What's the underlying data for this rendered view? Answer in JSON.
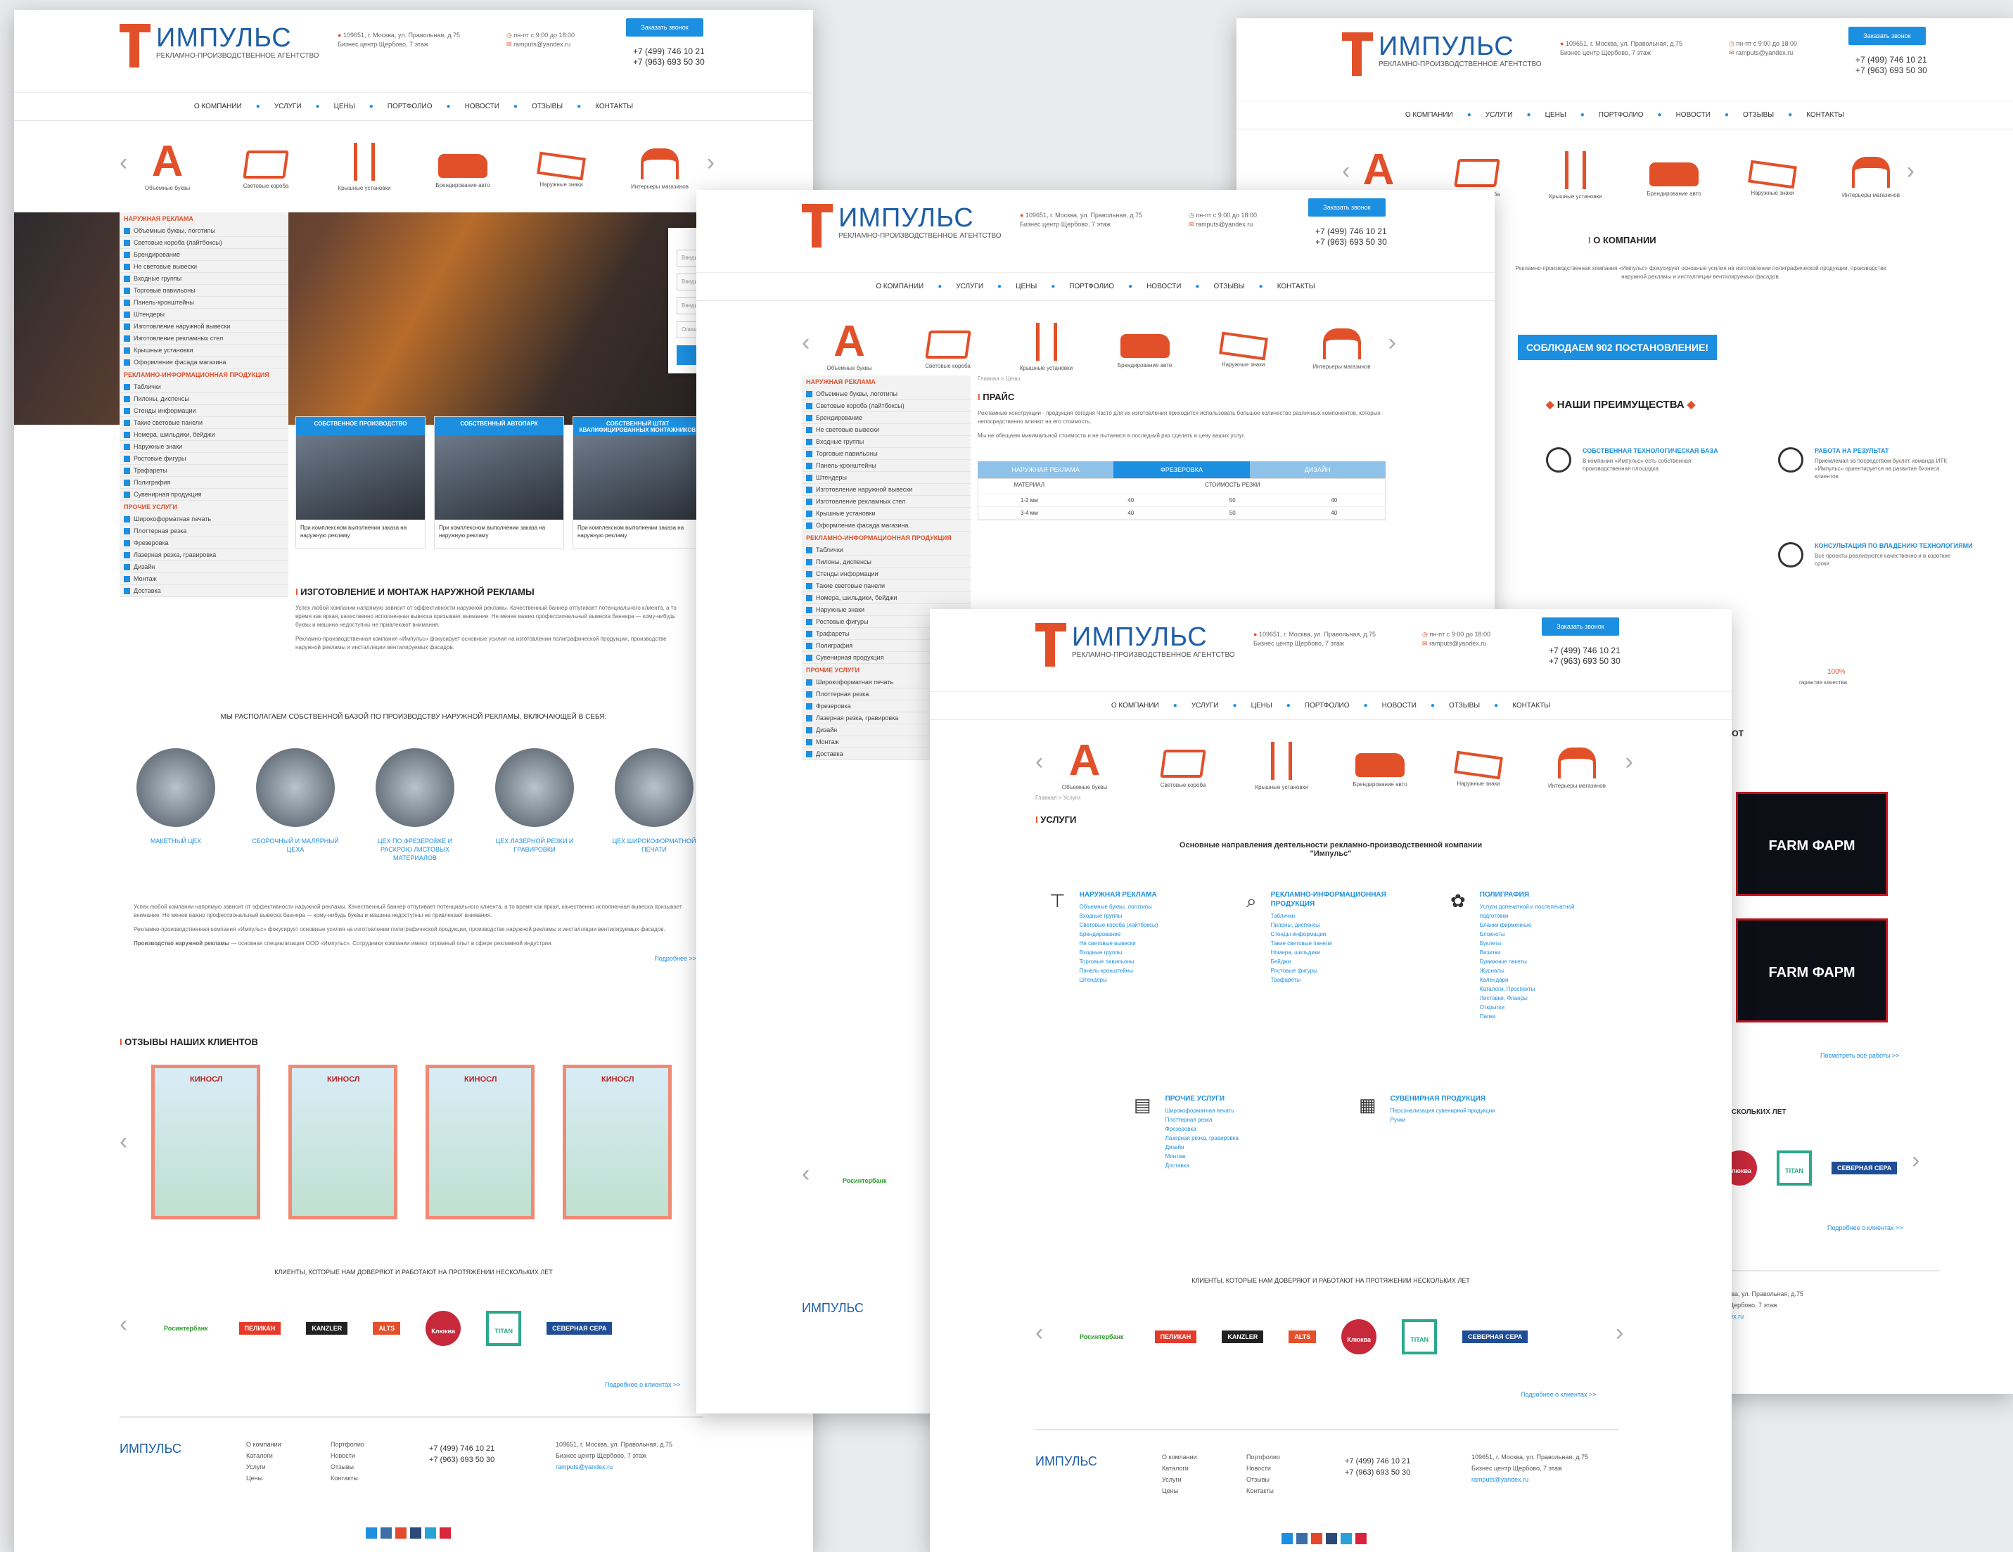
{
  "header": {
    "logo_name": "ИМПУЛЬС",
    "logo_sub": "РЕКЛАМНО-ПРОИЗВОДСТВЕННОЕ АГЕНТСТВО",
    "address": "109651, г. Москва, ул. Правольная, д.75",
    "address2": "Бизнес центр Щербово, 7 этаж",
    "hours": "пн-пт с 9:00 до 18:00",
    "email": "ramputs@yandex.ru",
    "phone1": "+7 (499) 746 10 21",
    "phone2": "+7 (963) 693 50 30",
    "callback": "Заказать звонок"
  },
  "menu": [
    "О КОМПАНИИ",
    "УСЛУГИ",
    "ЦЕНЫ",
    "ПОРТФОЛИО",
    "НОВОСТИ",
    "ОТЗЫВЫ",
    "КОНТАКТЫ"
  ],
  "products": [
    {
      "label": "Объемные буквы",
      "icon": "letter-a-icon"
    },
    {
      "label": "Световые короба",
      "icon": "light-box-icon"
    },
    {
      "label": "Крышные установки",
      "icon": "roof-stand-icon"
    },
    {
      "label": "Брендирование авто",
      "icon": "van-icon"
    },
    {
      "label": "Наружные знаки",
      "icon": "sign-icon"
    },
    {
      "label": "Интерьеры магазинов",
      "icon": "tent-icon"
    }
  ],
  "sidebar": {
    "cap1": "НАРУЖНАЯ РЕКЛАМА",
    "items1": [
      "Объемные буквы, логотипы",
      "Световые короба (лайтбоксы)",
      "Брендирование",
      "Не световые вывески",
      "Входные группы",
      "Торговые павильоны",
      "Панель-кронштейны",
      "Штендеры",
      "Изготовление наружной вывески",
      "Изготовление рекламных стел",
      "Крышные установки",
      "Оформление фасада магазина"
    ],
    "cap2": "РЕКЛАМНО-ИНФОРМАЦИОННАЯ ПРОДУКЦИЯ",
    "items2": [
      "Таблички",
      "Пилоны, диспенсы",
      "Стенды информации",
      "Такие световые панели",
      "Номера, шильдики, бейджи",
      "Наружные знаки",
      "Ростовые фигуры",
      "Трафареты",
      "Полиграфия",
      "Сувенирная продукция"
    ],
    "cap3": "ПРОЧИЕ УСЛУГИ",
    "items3": [
      "Широкоформатная печать",
      "Плоттерная резка",
      "Фрезеровка",
      "Лазерная резка, гравировка",
      "Дизайн",
      "Монтаж",
      "Доставка"
    ]
  },
  "order": {
    "title": "ОФОРМИТЬ ЗАКАЗ",
    "ph_name": "Введите Имя",
    "ph_phone": "Введите телефон",
    "ph_email": "Введите e-mail",
    "ph_service": "Опишите вид услуги",
    "submit": "ОТПРАВИТЬ"
  },
  "cards": [
    {
      "title": "СОБСТВЕННОЕ ПРОИЗВОДСТВО",
      "text": "При комплексном выполнении заказа на наружную рекламу"
    },
    {
      "title": "СОБСТВЕННЫЙ АВТОПАРК",
      "text": "При комплексном выполнении заказа на наружную рекламу"
    },
    {
      "title": "СОБСТВЕННЫЙ ШТАТ КВАЛИФИЦИРОВАННЫХ МОНТАЖНИКОВ",
      "text": "При комплексном выполнении заказа на наружную рекламу"
    }
  ],
  "main": {
    "section1_title": "ИЗГОТОВЛЕНИЕ И МОНТАЖ НАРУЖНОЙ РЕКЛАМЫ",
    "section1_text": "Успех любой компании напрямую зависит от эффективности наружной рекламы. Качественный баннер отпугивает потенциального клиента, а то время как яркая, качественно исполненная вывеска призывает внимание. Не менее важно профессиональный вывеска баннера — кому-нибудь буквы и машина недоступны не привлекают внимания.",
    "section1_text2": "Рекламно-производственная компания «Импульс» фокусирует основные усилия на изготовлении полиграфической продукции, производстве наружной рекламы и инсталляции вентилируемых фасадов.",
    "base_title": "МЫ РАСПОЛАГАЕМ СОБСТВЕННОЙ БАЗОЙ ПО ПРОИЗВОДСТВУ НАРУЖНОЙ РЕКЛАМЫ, ВКЛЮЧАЮЩЕЙ В СЕБЯ:",
    "circles": [
      "МАКЕТНЫЙ ЦЕХ",
      "СБОРОЧНЫЙ И МАЛЯРНЫЙ ЦЕХА",
      "ЦЕХ ПО ФРЕЗЕРОВКЕ И РАСКРОЮ ЛИСТОВЫХ МАТЕРИАЛОВ",
      "ЦЕХ ЛАЗЕРНОЙ РЕЗКИ И ГРАВИРОВКИ",
      "ЦЕХ ШИРОКОФОРМАТНОЙ ПЕЧАТИ"
    ],
    "para_lead": "Производство наружной рекламы",
    "para_rest": " — основная специализация ООО «Импульс». Сотрудники компании имеют огромный опыт в сфере рекламной индустрии.",
    "more": "Подробнее >>",
    "reviews_title": "ОТЗЫВЫ НАШИХ КЛИЕНТОВ",
    "review_label": "КИНОСЛ",
    "clients_title": "КЛИЕНТЫ, КОТОРЫЕ НАМ ДОВЕРЯЮТ И РАБОТАЮТ НА ПРОТЯЖЕНИИ НЕСКОЛЬКИХ ЛЕТ",
    "clients": [
      "Росинтербанк",
      "ПЕЛИКАН",
      "KANZLER",
      "ALTS",
      "Клюква",
      "TITAN",
      "СЕВЕРНАЯ СЕРА"
    ],
    "clients_more": "Подробнее о клиентах >>"
  },
  "footer": {
    "col1": [
      "О компании",
      "Каталоги",
      "Услуги",
      "Цены"
    ],
    "col2": [
      "Портфолио",
      "Новости",
      "Отзывы",
      "Контакты"
    ],
    "phone1": "+7 (499) 746 10 21",
    "phone2": "+7 (963) 693 50 30"
  },
  "price_page": {
    "breadcrumb": "Главная > Цены",
    "title": "ПРАЙС",
    "text": "Рекламные конструкции - продукция сегодня Часто для их изготовления приходится использовать большое количество различных компонентов, которые непосредственно влияют на его стоимость.",
    "text2": "Мы не обещаем минимальной стоимости и не пытаемся в последний раз сделать в цену ваших услуг.",
    "tabs": [
      "НАРУЖНАЯ РЕКЛАМА",
      "ФРЕЗЕРОВКА",
      "ДИЗАЙН"
    ],
    "col_material": "МАТЕРИАЛ",
    "col_cost": "СТОИМОСТЬ РЕЗКИ",
    "rows": [
      [
        "1-2 мм",
        "40",
        "50",
        "40"
      ],
      [
        "3-4 мм",
        "40",
        "50",
        "40"
      ]
    ],
    "client": "Росинтербанк"
  },
  "about_page": {
    "title": "О КОМПАНИИ",
    "text": "Рекламно-производственная компания «Импульс» фокусирует основные усилия на изготовлении полиграфической продукции, производстве наружной рекламы и инсталляции вентилируемых фасадов.",
    "badge": "СОБЛЮДАЕМ 902 ПОСТАНОВЛЕНИЕ!",
    "adv_title": "НАШИ ПРЕИМУЩЕСТВА",
    "adv": [
      {
        "title": "СОБСТВЕННАЯ ТЕХНОЛОГИЧЕСКАЯ БАЗА",
        "text": "В компании «Импульс» есть собственная производственная площадка"
      },
      {
        "title": "РАБОТА НА РЕЗУЛЬТАТ",
        "text": "Приемлемая за посредством буклет, команда ИТК «Импульс» ориентируется на развитие бизнеса клиентов"
      },
      {
        "title": "КОНСУЛЬТАЦИЯ ПО ВЛАДЕНИЮ ТЕХНОЛОГИЯМИ",
        "text": "Все проекты реализуются качественно и в короткие сроки"
      }
    ],
    "quality_value": "100%",
    "quality_text": "гарантия качества",
    "works_title": "РАБОТ",
    "farm": "FARM ФАРМ",
    "works_more": "Посмотреть все работы >>",
    "clients_years": "НЕСКОЛЬКИХ ЛЕТ"
  },
  "services_page": {
    "breadcrumb": "Главная > Услуги",
    "title": "УСЛУГИ",
    "subtitle": "Основные направления деятельности рекламно-производственной компании \"Импульс\"",
    "cols": [
      {
        "head": "НАРУЖНАЯ РЕКЛАМА",
        "icon": "billboard-icon",
        "items": [
          "Объемные буквы, логотипы",
          "Входные группы",
          "Световые короба (лайтбоксы)",
          "Брендирование",
          "Не световые вывески",
          "Входные группы",
          "Торговые павильоны",
          "Панель-кронштейны",
          "Штендеры"
        ]
      },
      {
        "head": "РЕКЛАМНО-ИНФОРМАЦИОННАЯ ПРОДУКЦИЯ",
        "icon": "megaphone-icon",
        "items": [
          "Таблички",
          "Пилоны, диспенсы",
          "Стенды информации",
          "Такие световые панели",
          "Номера, шильдики",
          "Бейджи",
          "Ростовые фигуры",
          "Трафареты"
        ]
      },
      {
        "head": "ПОЛИГРАФИЯ",
        "icon": "flower-icon",
        "items": [
          "Услуги допечатной и послепечатной подготовки",
          "Бланки фирменные",
          "Блокноты",
          "Буклеты",
          "Визитки",
          "Бумажные пакеты",
          "Журналы",
          "Календари",
          "Каталоги, Проспекты",
          "Листовки, Флаеры",
          "Открытки",
          "Папки"
        ]
      },
      {
        "head": "ПРОЧИЕ УСЛУГИ",
        "icon": "document-icon",
        "items": [
          "Широкоформатная печать",
          "Плоттерная резка",
          "Фрезеровка",
          "Лазерная резка, гравировка",
          "Дизайн",
          "Монтаж",
          "Доставка"
        ]
      },
      {
        "head": "СУВЕНИРНАЯ ПРОДУКЦИЯ",
        "icon": "map-icon",
        "items": [
          "Персонализация сувенирной продукции",
          "Ручки"
        ]
      }
    ]
  }
}
